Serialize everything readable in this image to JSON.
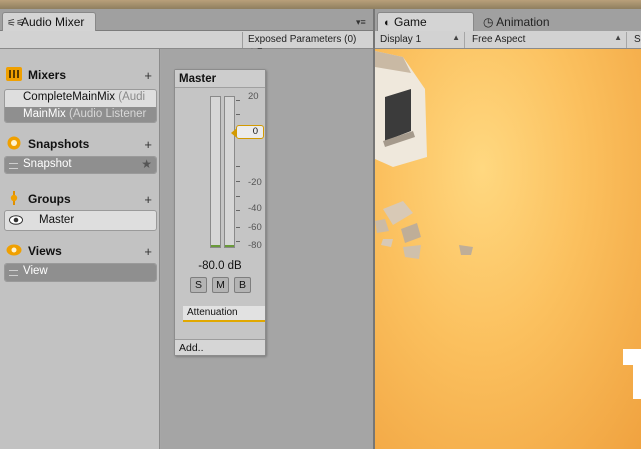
{
  "mixer_window": {
    "tab_label": "Audio Mixer",
    "tab_icon": "audio-mixer-icon",
    "exposed_params": "Exposed Parameters (0)"
  },
  "sections": {
    "mixers": {
      "title": "Mixers",
      "items": [
        {
          "name": "CompleteMainMix",
          "detail": "(Audi"
        },
        {
          "name": "MainMix",
          "detail": "(Audio Listener"
        }
      ]
    },
    "snapshots": {
      "title": "Snapshots",
      "items": [
        {
          "name": "Snapshot"
        }
      ]
    },
    "groups": {
      "title": "Groups",
      "items": [
        {
          "name": "Master"
        }
      ]
    },
    "views": {
      "title": "Views",
      "items": [
        {
          "name": "View"
        }
      ]
    }
  },
  "plus_label": "+",
  "strip": {
    "title": "Master",
    "fader_value": "0",
    "db_readout": "-80.0 dB",
    "buttons": [
      "S",
      "M",
      "B"
    ],
    "effect": "Attenuation",
    "add_label": "Add.."
  },
  "scale_labels": {
    "s20": "20",
    "sm20": "-20",
    "sm40": "-40",
    "sm60": "-60",
    "sm80": "-80"
  },
  "game_window": {
    "tab_label": "Game",
    "animation_tab": "Animation",
    "display": "Display 1",
    "aspect": "Free Aspect",
    "scale_partial": "Sc"
  },
  "colors": {
    "accent_orange": "#e1a800",
    "selection": "#8f8f8f",
    "game_bg": "#fbc05e"
  }
}
